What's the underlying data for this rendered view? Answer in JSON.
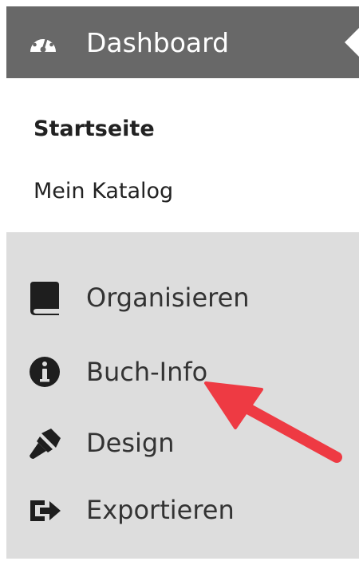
{
  "dashboard": {
    "label": "Dashboard",
    "icon": "dashboard-gauge-icon"
  },
  "submenu": {
    "items": [
      {
        "label": "Startseite",
        "active": true
      },
      {
        "label": "Mein Katalog",
        "active": false
      }
    ]
  },
  "menu": {
    "items": [
      {
        "label": "Organisieren",
        "icon": "book-icon"
      },
      {
        "label": "Buch-Info",
        "icon": "info-icon"
      },
      {
        "label": "Design",
        "icon": "paintbrush-icon"
      },
      {
        "label": "Exportieren",
        "icon": "export-icon"
      }
    ]
  },
  "annotation": {
    "arrow_color": "#ee3a43",
    "target": "Buch-Info"
  },
  "colors": {
    "header_bg": "#686868",
    "menu_bg": "#dddddd",
    "text": "#333333"
  }
}
